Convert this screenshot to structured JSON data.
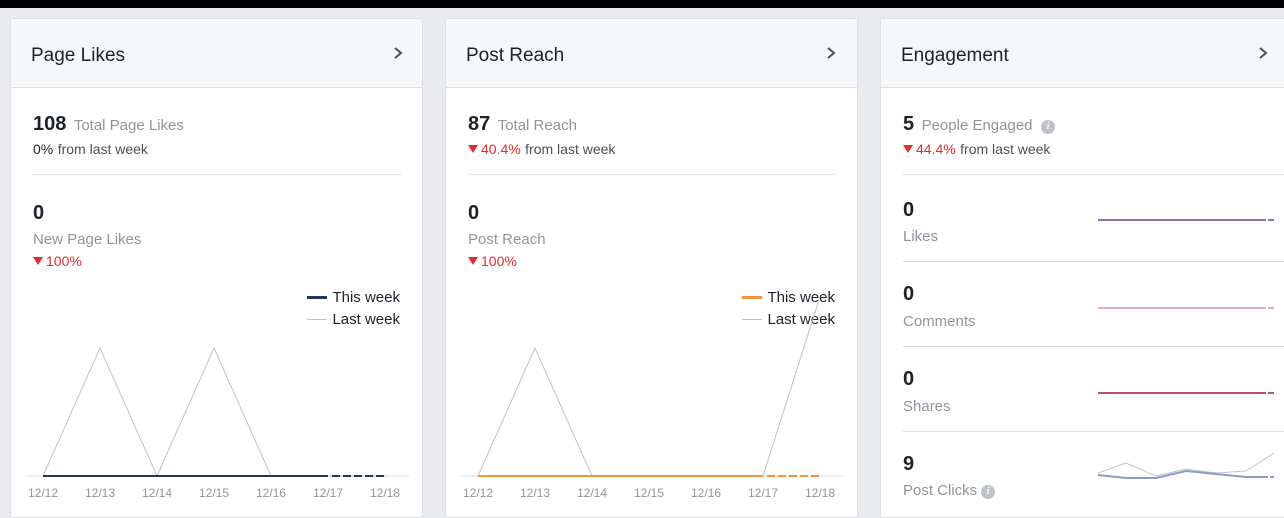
{
  "colors": {
    "red": "#e02c2c",
    "navy": "#243759",
    "orange": "#f7923a",
    "gray_line": "#bec2c9",
    "purple": "#8c72a6",
    "pink": "#e8a7c3",
    "rose": "#b74f77",
    "blue": "#8b9dc3"
  },
  "page_likes": {
    "title": "Page Likes",
    "total_value": "108",
    "total_label": "Total Page Likes",
    "change_value": "0%",
    "change_label": "from last week",
    "metric_value": "0",
    "metric_label": "New Page Likes",
    "metric_change": "100%",
    "legend_this": "This week",
    "legend_last": "Last week",
    "this_week_icon": "navy-line-swatch",
    "last_week_icon": "gray-line-swatch"
  },
  "post_reach": {
    "title": "Post Reach",
    "total_value": "87",
    "total_label": "Total Reach",
    "change_value": "40.4%",
    "change_label": "from last week",
    "metric_value": "0",
    "metric_label": "Post Reach",
    "metric_change": "100%",
    "legend_this": "This week",
    "legend_last": "Last week"
  },
  "engagement": {
    "title": "Engagement",
    "total_value": "5",
    "total_label": "People Engaged",
    "change_value": "44.4%",
    "change_label": "from last week",
    "items": [
      {
        "value": "0",
        "label": "Likes"
      },
      {
        "value": "0",
        "label": "Comments"
      },
      {
        "value": "0",
        "label": "Shares"
      },
      {
        "value": "9",
        "label": "Post Clicks"
      }
    ]
  },
  "chart_data": [
    {
      "type": "line",
      "categories": [
        "12/12",
        "12/13",
        "12/14",
        "12/15",
        "12/16",
        "12/17",
        "12/18"
      ],
      "series": [
        {
          "name": "This week",
          "values": [
            0,
            0,
            0,
            0,
            0,
            0,
            0
          ]
        },
        {
          "name": "Last week",
          "values": [
            0,
            1,
            0,
            1,
            0,
            0,
            0
          ]
        }
      ]
    },
    {
      "type": "line",
      "categories": [
        "12/12",
        "12/13",
        "12/14",
        "12/15",
        "12/16",
        "12/17",
        "12/18"
      ],
      "series": [
        {
          "name": "This week",
          "values": [
            0,
            0,
            0,
            0,
            0,
            0,
            0
          ]
        },
        {
          "name": "Last week",
          "values": [
            0,
            1,
            0,
            0,
            0,
            0,
            1.4
          ]
        }
      ]
    }
  ]
}
